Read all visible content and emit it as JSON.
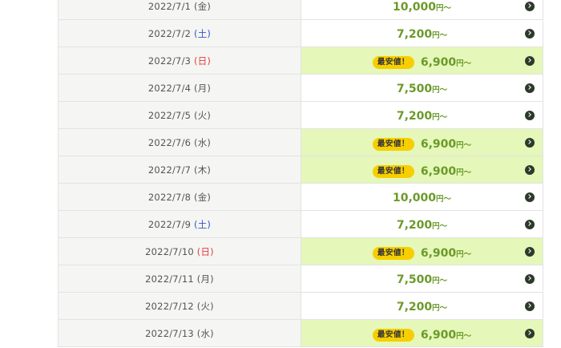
{
  "colors": {
    "sat": "#3355cc",
    "sun": "#e04040",
    "weekday": "#555555",
    "price": "#6b9a2a",
    "cheapest_bg": "#e5f7b9",
    "badge": "#f7cf00"
  },
  "rows": [
    {
      "date": "2022/7/1",
      "day": "(金)",
      "day_type": "weekday",
      "cheapest": false,
      "badge": "",
      "amount": "10,000",
      "unit": "円～"
    },
    {
      "date": "2022/7/2",
      "day": "(土)",
      "day_type": "sat",
      "cheapest": false,
      "badge": "",
      "amount": "7,200",
      "unit": "円～"
    },
    {
      "date": "2022/7/3",
      "day": "(日)",
      "day_type": "sun",
      "cheapest": true,
      "badge": "最安値！",
      "amount": "6,900",
      "unit": "円～"
    },
    {
      "date": "2022/7/4",
      "day": "(月)",
      "day_type": "weekday",
      "cheapest": false,
      "badge": "",
      "amount": "7,500",
      "unit": "円～"
    },
    {
      "date": "2022/7/5",
      "day": "(火)",
      "day_type": "weekday",
      "cheapest": false,
      "badge": "",
      "amount": "7,200",
      "unit": "円～"
    },
    {
      "date": "2022/7/6",
      "day": "(水)",
      "day_type": "weekday",
      "cheapest": true,
      "badge": "最安値！",
      "amount": "6,900",
      "unit": "円～"
    },
    {
      "date": "2022/7/7",
      "day": "(木)",
      "day_type": "weekday",
      "cheapest": true,
      "badge": "最安値！",
      "amount": "6,900",
      "unit": "円～"
    },
    {
      "date": "2022/7/8",
      "day": "(金)",
      "day_type": "weekday",
      "cheapest": false,
      "badge": "",
      "amount": "10,000",
      "unit": "円～"
    },
    {
      "date": "2022/7/9",
      "day": "(土)",
      "day_type": "sat",
      "cheapest": false,
      "badge": "",
      "amount": "7,200",
      "unit": "円～"
    },
    {
      "date": "2022/7/10",
      "day": "(日)",
      "day_type": "sun",
      "cheapest": true,
      "badge": "最安値！",
      "amount": "6,900",
      "unit": "円～"
    },
    {
      "date": "2022/7/11",
      "day": "(月)",
      "day_type": "weekday",
      "cheapest": false,
      "badge": "",
      "amount": "7,500",
      "unit": "円～"
    },
    {
      "date": "2022/7/12",
      "day": "(火)",
      "day_type": "weekday",
      "cheapest": false,
      "badge": "",
      "amount": "7,200",
      "unit": "円～"
    },
    {
      "date": "2022/7/13",
      "day": "(水)",
      "day_type": "weekday",
      "cheapest": true,
      "badge": "最安値！",
      "amount": "6,900",
      "unit": "円～"
    }
  ]
}
